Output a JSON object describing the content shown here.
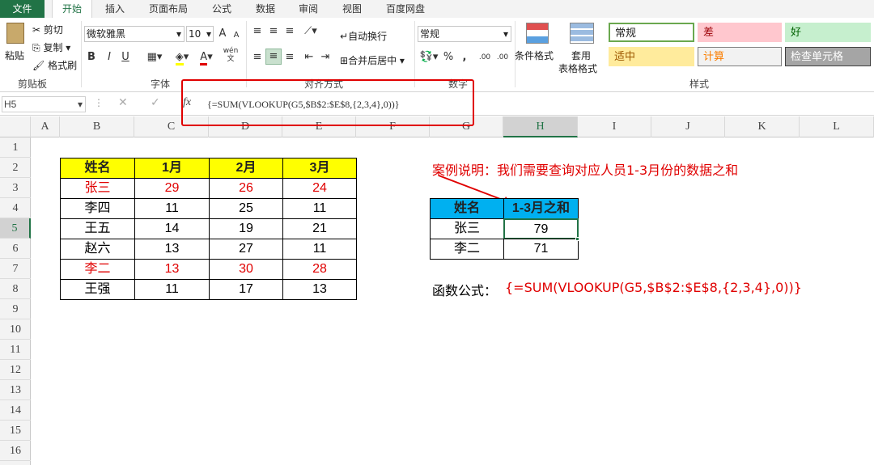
{
  "tabs": [
    "文件",
    "开始",
    "插入",
    "页面布局",
    "公式",
    "数据",
    "审阅",
    "视图",
    "百度网盘"
  ],
  "clipboard": {
    "paste": "粘贴",
    "cut": "剪切",
    "copy": "复制",
    "format_painter": "格式刷",
    "group": "剪贴板"
  },
  "font": {
    "name": "微软雅黑",
    "size": "10",
    "grow": "A",
    "shrink": "A",
    "bold": "B",
    "italic": "I",
    "underline": "U",
    "font_color_label": "A",
    "phonetic": "wén",
    "phonetic2": "文",
    "group": "字体"
  },
  "alignment": {
    "wrap": "自动换行",
    "merge": "合并后居中",
    "group": "对齐方式"
  },
  "number": {
    "format": "常规",
    "percent": "%",
    "comma": ",",
    "inc_dec": ".00",
    "group": "数字"
  },
  "styles_group": {
    "conditional": "条件格式",
    "table_line1": "套用",
    "table_line2": "表格格式",
    "group": "样式",
    "items": [
      {
        "label": "常规",
        "bg": "#ffffff",
        "color": "#222222",
        "border": "#6aa84f"
      },
      {
        "label": "差",
        "bg": "#ffc7ce",
        "color": "#9c0006",
        "border": "#ffc7ce"
      },
      {
        "label": "好",
        "bg": "#c6efce",
        "color": "#006100",
        "border": "#c6efce"
      },
      {
        "label": "适中",
        "bg": "#ffeb9c",
        "color": "#9c5700",
        "border": "#ffeb9c"
      },
      {
        "label": "计算",
        "bg": "#f2f2f2",
        "color": "#fa7d00",
        "border": "#7f7f7f"
      },
      {
        "label": "检查单元格",
        "bg": "#a5a5a5",
        "color": "#ffffff",
        "border": "#3f3f3f"
      }
    ]
  },
  "formula_bar": {
    "name_box": "H5",
    "fx": "fx",
    "formula": "{=SUM(VLOOKUP(G5,$B$2:$E$8,{2,3,4},0))}"
  },
  "columns": [
    "A",
    "B",
    "C",
    "D",
    "E",
    "F",
    "G",
    "H",
    "I",
    "J",
    "K",
    "L"
  ],
  "rows": [
    "1",
    "2",
    "3",
    "4",
    "5",
    "6",
    "7",
    "8",
    "9",
    "10",
    "11",
    "12",
    "13",
    "14",
    "15",
    "16"
  ],
  "main_table": {
    "headers": [
      "姓名",
      "1月",
      "2月",
      "3月"
    ],
    "rows": [
      {
        "name": "张三",
        "v": [
          "29",
          "26",
          "24"
        ],
        "color": "#e00000"
      },
      {
        "name": "李四",
        "v": [
          "11",
          "25",
          "11"
        ],
        "color": "#000000"
      },
      {
        "name": "王五",
        "v": [
          "14",
          "19",
          "21"
        ],
        "color": "#000000"
      },
      {
        "name": "赵六",
        "v": [
          "13",
          "27",
          "11"
        ],
        "color": "#000000"
      },
      {
        "name": "李二",
        "v": [
          "13",
          "30",
          "28"
        ],
        "color": "#e00000"
      },
      {
        "name": "王强",
        "v": [
          "11",
          "17",
          "13"
        ],
        "color": "#000000"
      }
    ]
  },
  "result_table": {
    "headers": [
      "姓名",
      "1-3月之和"
    ],
    "rows": [
      [
        "张三",
        "79"
      ],
      [
        "李二",
        "71"
      ]
    ]
  },
  "note": "案例说明：我们需要查询对应人员1-3月份的数据之和",
  "formula_label": "函数公式：",
  "formula_text": "{=SUM(VLOOKUP(G5,$B$2:$E$8,{2,3,4},0))}",
  "colors": {
    "accent": "#217346",
    "header_yellow": "#ffff00",
    "header_cyan": "#00b0f0",
    "red": "#e00000"
  }
}
